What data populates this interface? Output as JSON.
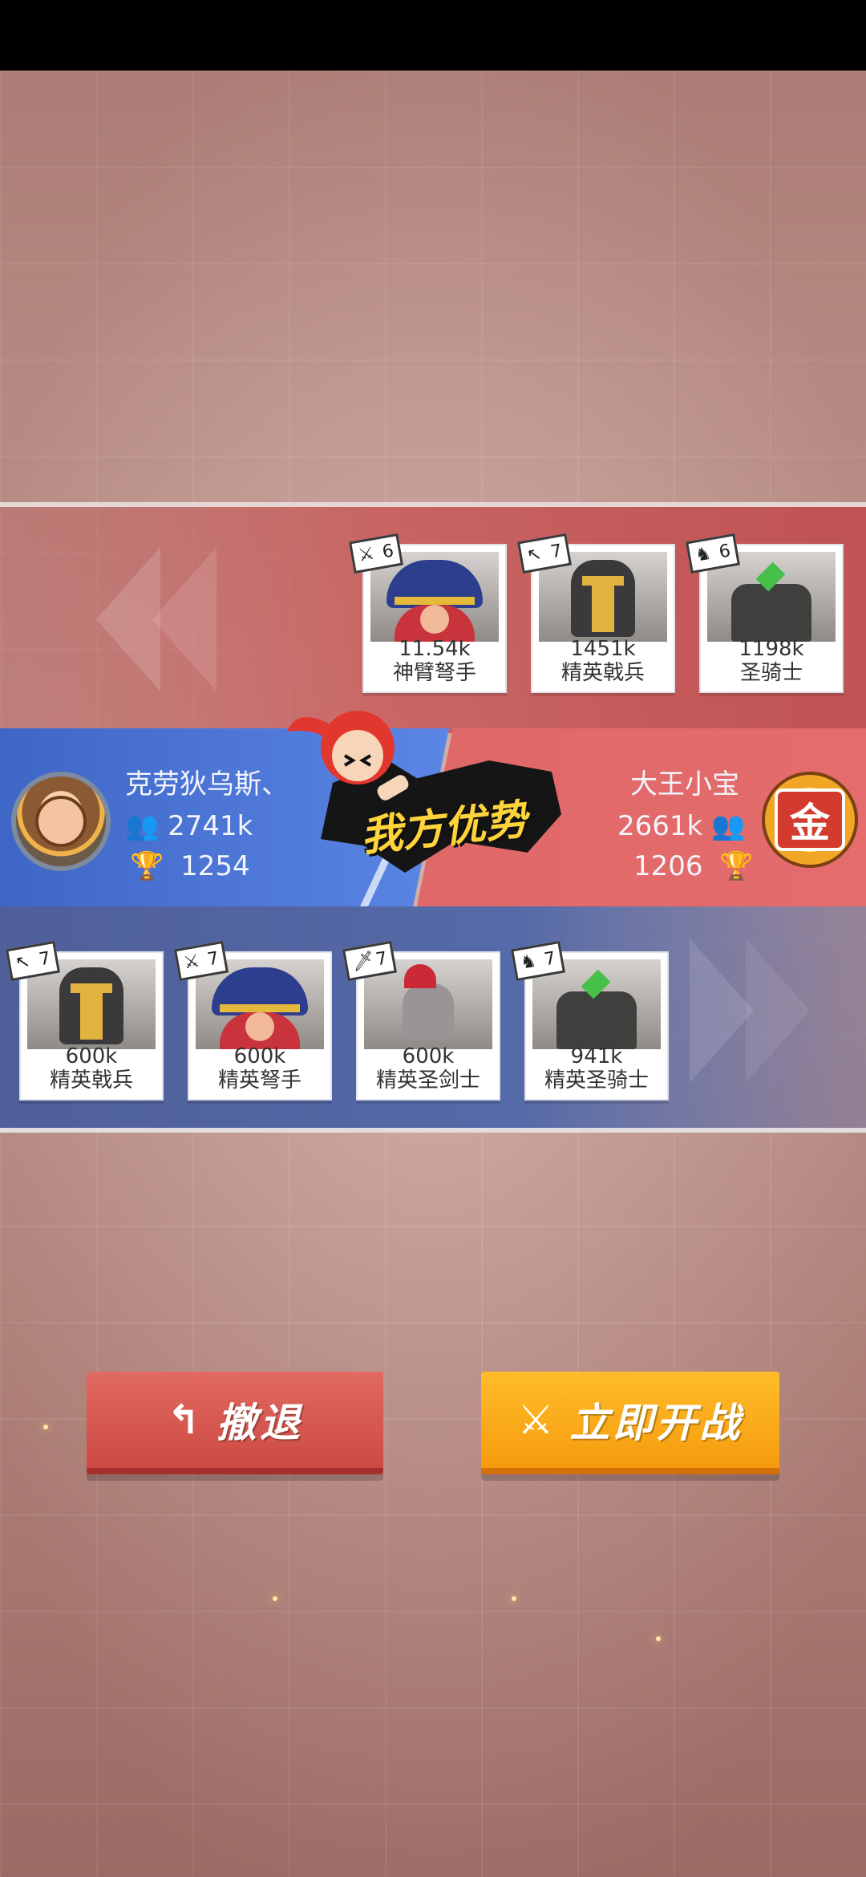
{
  "enemy": {
    "name": "大王小宝",
    "troops": "2661k",
    "trophies": "1206",
    "badge": "金",
    "units": [
      {
        "level": "6",
        "weapon": "crossbow-icon",
        "power": "11.54k",
        "name": "神臂弩手"
      },
      {
        "level": "7",
        "weapon": "spear-icon",
        "power": "1451k",
        "name": "精英戟兵"
      },
      {
        "level": "6",
        "weapon": "horse-icon",
        "power": "1198k",
        "name": "圣骑士"
      }
    ]
  },
  "player": {
    "name": "克劳狄乌斯、",
    "troops": "2741k",
    "trophies": "1254",
    "units": [
      {
        "level": "7",
        "weapon": "spear-icon",
        "power": "600k",
        "name": "精英戟兵"
      },
      {
        "level": "7",
        "weapon": "crossbow-icon",
        "power": "600k",
        "name": "精英弩手"
      },
      {
        "level": "7",
        "weapon": "sword-icon",
        "power": "600k",
        "name": "精英圣剑士"
      },
      {
        "level": "7",
        "weapon": "horse-icon",
        "power": "941k",
        "name": "精英圣骑士"
      }
    ]
  },
  "advantage_text": "我方优势",
  "buttons": {
    "retreat": "撤退",
    "fight": "立即开战"
  },
  "colors": {
    "ally": "#4a72d4",
    "enemy": "#e06868",
    "fight": "#f7a414",
    "retreat": "#d9524a"
  }
}
